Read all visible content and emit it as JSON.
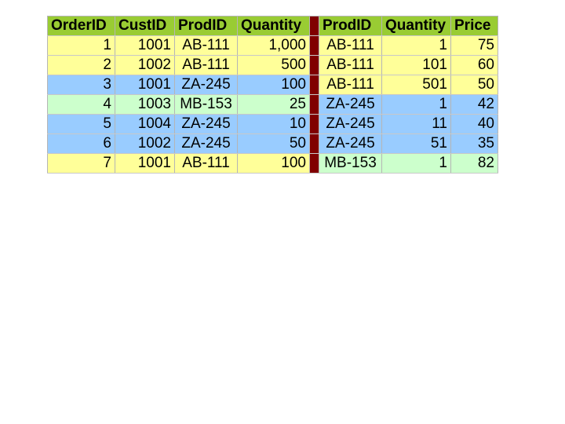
{
  "colors": {
    "header_bg": "#99cc33",
    "yellow": "#ffff99",
    "blue": "#99ccff",
    "green": "#ccffcc",
    "separator": "#800000"
  },
  "orders": {
    "headers": [
      "OrderID",
      "CustID",
      "ProdID",
      "Quantity"
    ],
    "rows": [
      {
        "order_id": "1",
        "cust_id": "1001",
        "prod_id": "AB-111",
        "quantity": "1,000",
        "color": "yellow"
      },
      {
        "order_id": "2",
        "cust_id": "1002",
        "prod_id": "AB-111",
        "quantity": "500",
        "color": "yellow"
      },
      {
        "order_id": "3",
        "cust_id": "1001",
        "prod_id": "ZA-245",
        "quantity": "100",
        "color": "blue"
      },
      {
        "order_id": "4",
        "cust_id": "1003",
        "prod_id": "MB-153",
        "quantity": "25",
        "color": "green"
      },
      {
        "order_id": "5",
        "cust_id": "1004",
        "prod_id": "ZA-245",
        "quantity": "10",
        "color": "blue"
      },
      {
        "order_id": "6",
        "cust_id": "1002",
        "prod_id": "ZA-245",
        "quantity": "50",
        "color": "blue"
      },
      {
        "order_id": "7",
        "cust_id": "1001",
        "prod_id": "AB-111",
        "quantity": "100",
        "color": "yellow"
      }
    ]
  },
  "prices": {
    "headers": [
      "ProdID",
      "Quantity",
      "Price"
    ],
    "rows": [
      {
        "prod_id": "AB-111",
        "quantity": "1",
        "price": "75",
        "color": "yellow"
      },
      {
        "prod_id": "AB-111",
        "quantity": "101",
        "price": "60",
        "color": "yellow"
      },
      {
        "prod_id": "AB-111",
        "quantity": "501",
        "price": "50",
        "color": "yellow"
      },
      {
        "prod_id": "ZA-245",
        "quantity": "1",
        "price": "42",
        "color": "blue"
      },
      {
        "prod_id": "ZA-245",
        "quantity": "11",
        "price": "40",
        "color": "blue"
      },
      {
        "prod_id": "ZA-245",
        "quantity": "51",
        "price": "35",
        "color": "blue"
      },
      {
        "prod_id": "MB-153",
        "quantity": "1",
        "price": "82",
        "color": "green"
      }
    ]
  }
}
